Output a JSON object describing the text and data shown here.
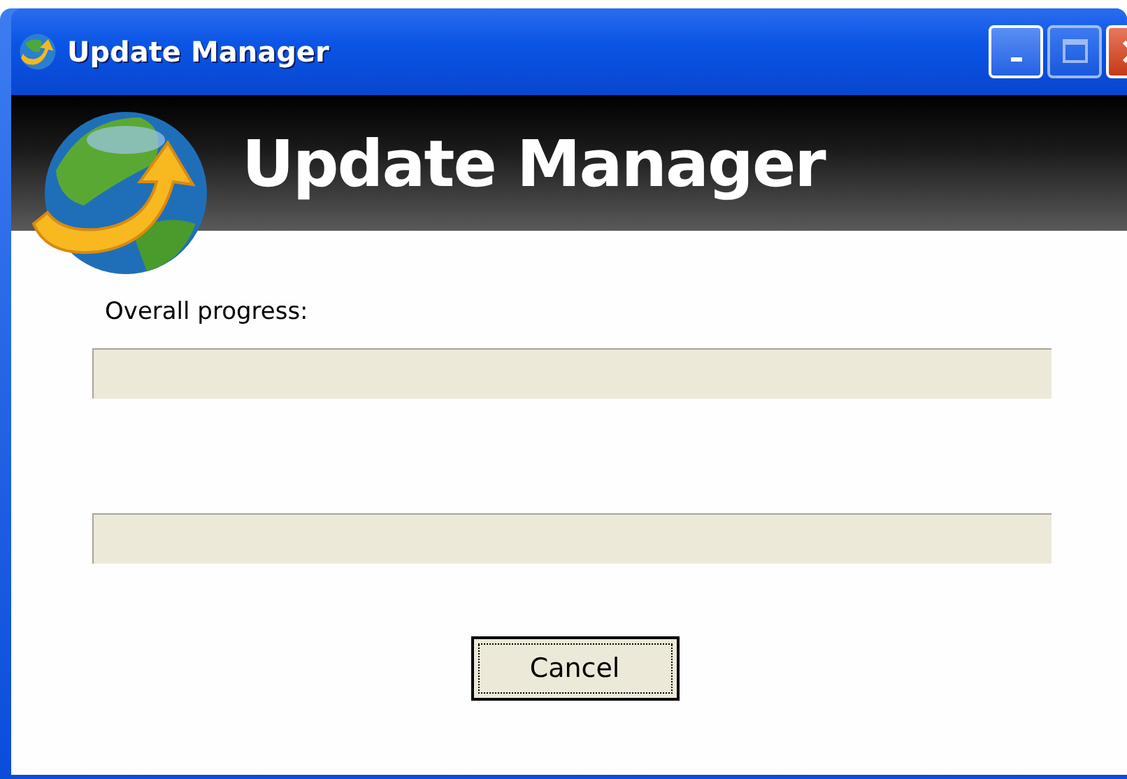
{
  "window": {
    "title": "Update Manager"
  },
  "banner": {
    "title": "Update Manager"
  },
  "progress_label": "Overall progress:",
  "progress_bars": [
    {
      "level": 0
    },
    {
      "level": 0
    }
  ],
  "buttons": [
    {
      "label": "Cancel",
      "focused": true
    }
  ]
}
